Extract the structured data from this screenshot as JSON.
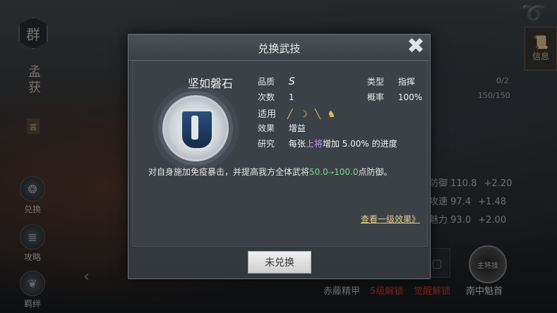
{
  "hero": {
    "faction": "群",
    "name": "孟获",
    "tag": "酱"
  },
  "side_menu": [
    {
      "label": "兑换",
      "icon": "exchange-icon"
    },
    {
      "label": "攻略",
      "icon": "guide-book-icon"
    },
    {
      "label": "羁绊",
      "icon": "bond-icon"
    }
  ],
  "top_right": {
    "info_label": "信息"
  },
  "background_stats": {
    "bar1": "0/2",
    "bar2": "150/150",
    "lines": [
      {
        "name": "防御",
        "value": "110.8",
        "bonus": "+2.20"
      },
      {
        "name": "攻速",
        "value": "97.4",
        "bonus": "+1.48"
      },
      {
        "name": "魅力",
        "value": "93.0",
        "bonus": "+2.00"
      }
    ]
  },
  "bottom_bar": {
    "item1": "赤藤精甲",
    "item2": "5级解锁",
    "item3": "觉醒解锁",
    "item4": "南中魁首",
    "badge": "主将技"
  },
  "modal": {
    "title": "兑换武技",
    "skill_name": "坚如磐石",
    "props": {
      "quality_label": "品质",
      "quality_value": "S",
      "count_label": "次数",
      "count_value": "1",
      "suitable_label": "适用",
      "effect_label": "效果",
      "effect_value": "增益",
      "research_label": "研究",
      "research_prefix": "每张",
      "research_word": "上将",
      "research_suffix": "增加 5.00% 的进度",
      "type_label": "类型",
      "type_value": "指挥",
      "rate_label": "概率",
      "rate_value": "100%"
    },
    "desc_prefix": "对自身施加免疫暴击，并提高我方全体武将",
    "desc_value_from": "50.0",
    "desc_arrow": "→",
    "desc_value_to": "100.0",
    "desc_suffix": "点防御。",
    "link_label": "查看一级效果》",
    "button_label": "未兑换",
    "accent_purple": "#c79bff",
    "accent_green": "#7dd887"
  }
}
